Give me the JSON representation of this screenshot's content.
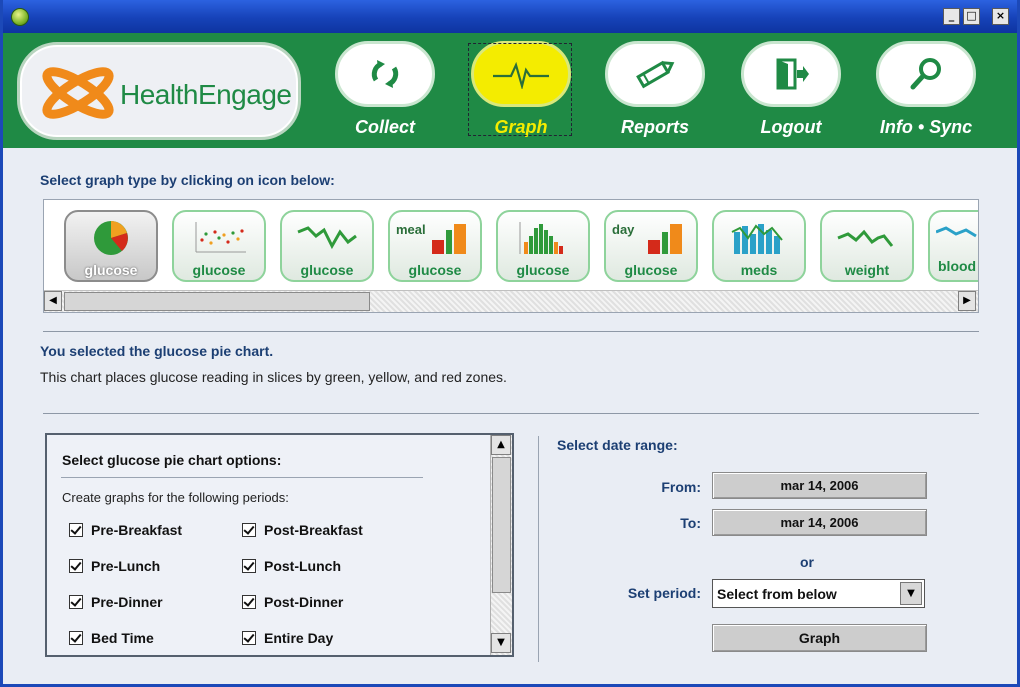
{
  "window": {
    "minimize": "_",
    "maximize": "□",
    "close": "×"
  },
  "brand": {
    "name": "HealthEngage",
    "color": "#1f8a45",
    "accent": "#f4ec00"
  },
  "nav": [
    {
      "label": "Collect",
      "icon": "refresh-icon"
    },
    {
      "label": "Graph",
      "icon": "heartbeat-icon",
      "active": true
    },
    {
      "label": "Reports",
      "icon": "pencil-icon"
    },
    {
      "label": "Logout",
      "icon": "exit-door-icon"
    },
    {
      "label": "Info • Sync",
      "icon": "magnifier-icon"
    }
  ],
  "graph_select": {
    "title": "Select graph type by clicking on icon below:",
    "items": [
      {
        "label": "glucose",
        "type": "pie",
        "selected": true
      },
      {
        "label": "glucose",
        "type": "scatter"
      },
      {
        "label": "glucose",
        "type": "line"
      },
      {
        "label": "glucose",
        "type": "bar-meal",
        "tag": "meal"
      },
      {
        "label": "glucose",
        "type": "bar-histogram"
      },
      {
        "label": "glucose",
        "type": "bar-day",
        "tag": "day"
      },
      {
        "label": "meds",
        "type": "bar-meds"
      },
      {
        "label": "weight",
        "type": "line-weight"
      },
      {
        "label": "blood press",
        "type": "line-bp"
      }
    ]
  },
  "selection": {
    "title": "You selected the glucose pie chart.",
    "description": "This chart places glucose reading in slices by green, yellow, and red zones."
  },
  "options": {
    "title": "Select glucose pie chart options:",
    "subtitle": "Create graphs for the following periods:",
    "periods": [
      {
        "label": "Pre-Breakfast",
        "checked": true
      },
      {
        "label": "Post-Breakfast",
        "checked": true
      },
      {
        "label": "Pre-Lunch",
        "checked": true
      },
      {
        "label": "Post-Lunch",
        "checked": true
      },
      {
        "label": "Pre-Dinner",
        "checked": true
      },
      {
        "label": "Post-Dinner",
        "checked": true
      },
      {
        "label": "Bed Time",
        "checked": true
      },
      {
        "label": "Entire Day",
        "checked": true
      }
    ]
  },
  "date_range": {
    "title": "Select date range:",
    "from_label": "From:",
    "from_value": "mar 14, 2006",
    "to_label": "To:",
    "to_value": "mar 14, 2006",
    "or_label": "or",
    "period_label": "Set period:",
    "period_value": "Select from below",
    "graph_button": "Graph"
  }
}
